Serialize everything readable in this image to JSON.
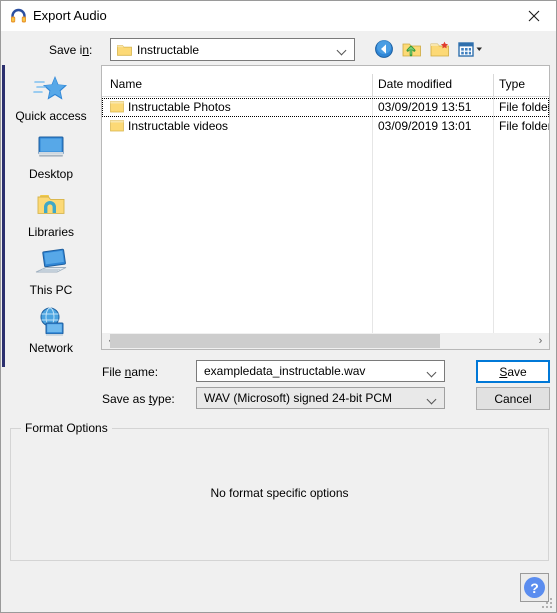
{
  "window": {
    "title": "Export Audio",
    "icon": "audacity-headphones-icon",
    "close_label": "✕"
  },
  "toolbar": {
    "save_in_label": "Save in:",
    "current_folder": "Instructable",
    "icons": [
      {
        "name": "back-navigation-icon",
        "label": "Back"
      },
      {
        "name": "up-one-level-icon",
        "label": "Up One Level"
      },
      {
        "name": "create-new-folder-icon",
        "label": "Create New Folder"
      },
      {
        "name": "view-menu-icon",
        "label": "View Menu"
      }
    ]
  },
  "places": {
    "items": [
      {
        "label": "Quick access",
        "icon": "quick-access-star-icon"
      },
      {
        "label": "Desktop",
        "icon": "desktop-monitor-icon"
      },
      {
        "label": "Libraries",
        "icon": "libraries-folder-icon"
      },
      {
        "label": "This PC",
        "icon": "this-pc-computer-icon"
      },
      {
        "label": "Network",
        "icon": "network-globe-icon"
      }
    ]
  },
  "filelist": {
    "columns": [
      "Name",
      "Date modified",
      "Type"
    ],
    "sort_indicator": "ascending",
    "rows": [
      {
        "name": "Instructable Photos",
        "date_modified": "03/09/2019 13:51",
        "type": "File folder",
        "icon": "folder-icon",
        "focused": true
      },
      {
        "name": "Instructable videos",
        "date_modified": "03/09/2019 13:01",
        "type": "File folder",
        "icon": "folder-icon",
        "focused": false
      }
    ],
    "scrollbar": {
      "left_arrow": "‹",
      "right_arrow": "›"
    }
  },
  "form": {
    "file_name_label": "File name:",
    "file_name_mnemonic": "n",
    "file_name_value": "exampledata_instructable.wav",
    "save_as_type_label": "Save as type:",
    "save_as_type_mnemonic": "t",
    "save_as_type_value": "WAV (Microsoft) signed 24-bit PCM",
    "save_button": "Save",
    "save_button_mnemonic": "S",
    "cancel_button": "Cancel"
  },
  "format_options": {
    "title": "Format Options",
    "message": "No format specific options"
  },
  "help": {
    "label": "?"
  },
  "colors": {
    "accent_focus": "#0078D7",
    "places_accent": "#2B2F6E",
    "folder_yellow": "#FCD976",
    "help_blue": "#5B8DEF",
    "window_bg": "#F0F0F0",
    "list_bg": "#FFFFFF"
  }
}
